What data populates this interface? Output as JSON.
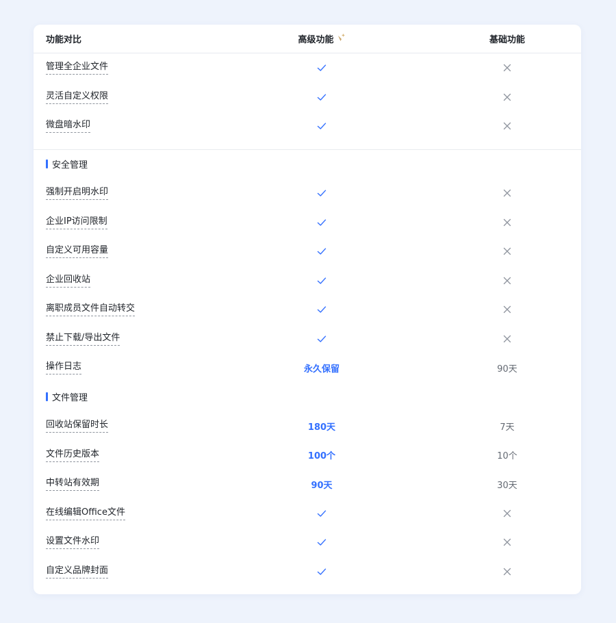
{
  "header": {
    "feature_col": "功能对比",
    "advanced_col": "高级功能",
    "basic_col": "基础功能",
    "advanced_icon": "sparkle-icon"
  },
  "colors": {
    "accent": "#3370ff",
    "check": "#3370ff",
    "cross": "#8f959e",
    "sparkle": "#c9a56a"
  },
  "group1": [
    {
      "name": "管理全企业文件",
      "advanced": "check",
      "basic": "cross"
    },
    {
      "name": "灵活自定义权限",
      "advanced": "check",
      "basic": "cross"
    },
    {
      "name": "微盘暗水印",
      "advanced": "check",
      "basic": "cross"
    }
  ],
  "section_security": {
    "title": "安全管理",
    "items": [
      {
        "name": "强制开启明水印",
        "advanced": "check",
        "basic": "cross"
      },
      {
        "name": "企业IP访问限制",
        "advanced": "check",
        "basic": "cross"
      },
      {
        "name": "自定义可用容量",
        "advanced": "check",
        "basic": "cross"
      },
      {
        "name": "企业回收站",
        "advanced": "check",
        "basic": "cross"
      },
      {
        "name": "离职成员文件自动转交",
        "advanced": "check",
        "basic": "cross"
      },
      {
        "name": "禁止下载/导出文件",
        "advanced": "check",
        "basic": "cross"
      },
      {
        "name": "操作日志",
        "advanced": "永久保留",
        "basic": "90天"
      }
    ]
  },
  "section_files": {
    "title": "文件管理",
    "items": [
      {
        "name": "回收站保留时长",
        "advanced": "180天",
        "basic": "7天"
      },
      {
        "name": "文件历史版本",
        "advanced": "100个",
        "basic": "10个"
      },
      {
        "name": "中转站有效期",
        "advanced": "90天",
        "basic": "30天"
      },
      {
        "name": "在线编辑Office文件",
        "advanced": "check",
        "basic": "cross"
      },
      {
        "name": "设置文件水印",
        "advanced": "check",
        "basic": "cross"
      },
      {
        "name": "自定义品牌封面",
        "advanced": "check",
        "basic": "cross"
      }
    ]
  }
}
